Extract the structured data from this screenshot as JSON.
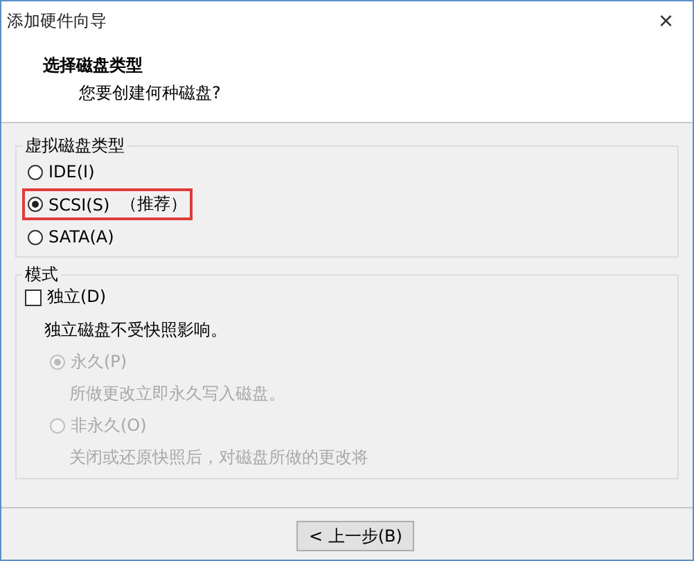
{
  "window": {
    "title": "添加硬件向导",
    "close": "×"
  },
  "header": {
    "title": "选择磁盘类型",
    "subtitle": "您要创建何种磁盘?"
  },
  "disk_type": {
    "legend": "虚拟磁盘类型",
    "options": [
      {
        "label": "IDE(I)",
        "selected": false,
        "highlighted": false
      },
      {
        "label": "SCSI(S)",
        "note": "（推荐）",
        "selected": true,
        "highlighted": true
      },
      {
        "label": "SATA(A)",
        "selected": false,
        "highlighted": false
      }
    ]
  },
  "mode": {
    "legend": "模式",
    "independent": {
      "label": "独立(D)",
      "checked": false
    },
    "description": "独立磁盘不受快照影响。",
    "options": [
      {
        "label": "永久(P)",
        "description": "所做更改立即永久写入磁盘。",
        "selected": true,
        "disabled": true
      },
      {
        "label": "非永久(O)",
        "description": "关闭或还原快照后，对磁盘所做的更改将",
        "selected": false,
        "disabled": true
      }
    ]
  },
  "buttons": [
    {
      "label": "< 上一步(B)"
    }
  ]
}
